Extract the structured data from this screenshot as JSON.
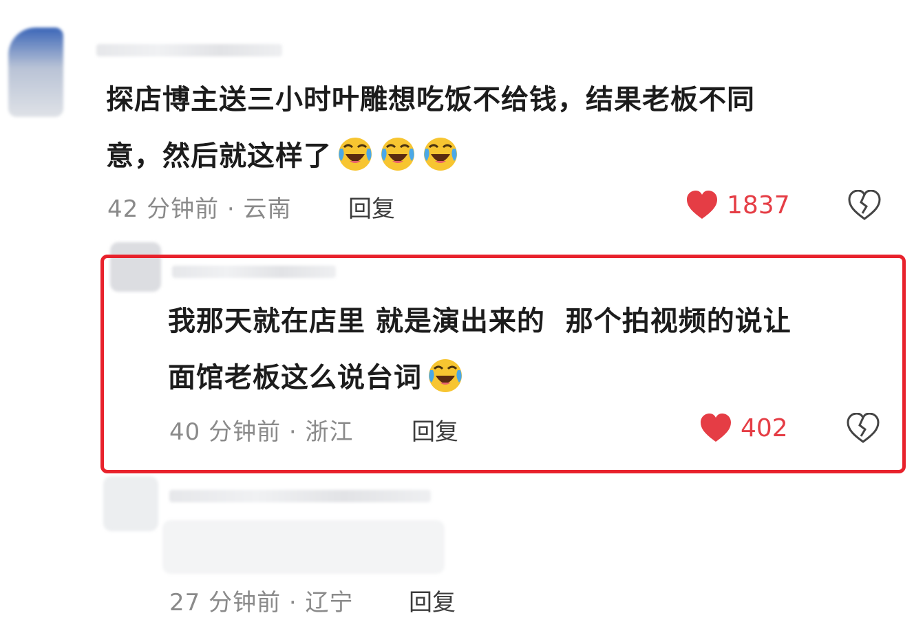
{
  "comments": [
    {
      "text_line1": "探店博主送三小时叶雕想吃饭不给钱，结果老板不同",
      "text_line2": "意，然后就这样了",
      "time": "42 分钟前",
      "location": "云南",
      "reply_label": "回复",
      "likes": "1837"
    },
    {
      "text_line1": "我那天就在店里 就是演出来的  那个拍视频的说让",
      "text_line2": "面馆老板这么说台词",
      "time": "40 分钟前",
      "location": "浙江",
      "reply_label": "回复",
      "likes": "402"
    },
    {
      "time": "27 分钟前",
      "location": "辽宁",
      "reply_label": "回复"
    }
  ],
  "separator": " · ",
  "colors": {
    "highlight": "#e8222c",
    "like": "#e53d45",
    "meta": "#8a8a8a"
  },
  "icons": [
    "crying-laughing-emoji",
    "heart-icon",
    "broken-heart-icon"
  ]
}
